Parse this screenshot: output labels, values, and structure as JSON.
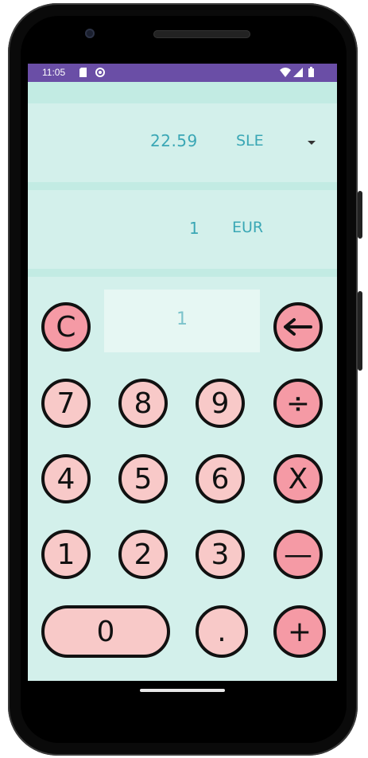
{
  "status_bar": {
    "time": "11:05",
    "left_icons": [
      "sd-card-icon",
      "sync-icon"
    ],
    "right_icons": [
      "wifi-icon",
      "signal-icon",
      "battery-icon"
    ]
  },
  "converter": {
    "top_row": {
      "amount": "22.59",
      "currency": "SLE",
      "has_dropdown": true
    },
    "bottom_row": {
      "amount": "1",
      "currency": "EUR"
    }
  },
  "display": {
    "value": "1"
  },
  "keypad": {
    "clear": "C",
    "backspace_icon": "backspace-arrow-icon",
    "divide": "÷",
    "multiply": "X",
    "subtract": "—",
    "add": "+",
    "digits": [
      "7",
      "8",
      "9",
      "4",
      "5",
      "6",
      "1",
      "2",
      "3",
      "0"
    ],
    "decimal": "."
  },
  "colors": {
    "status_bar": "#6a4ea6",
    "background": "#d3f0eb",
    "text_accent": "#3aa7b5",
    "number_key": "#f8c9c8",
    "operator_key": "#f59aa5"
  }
}
